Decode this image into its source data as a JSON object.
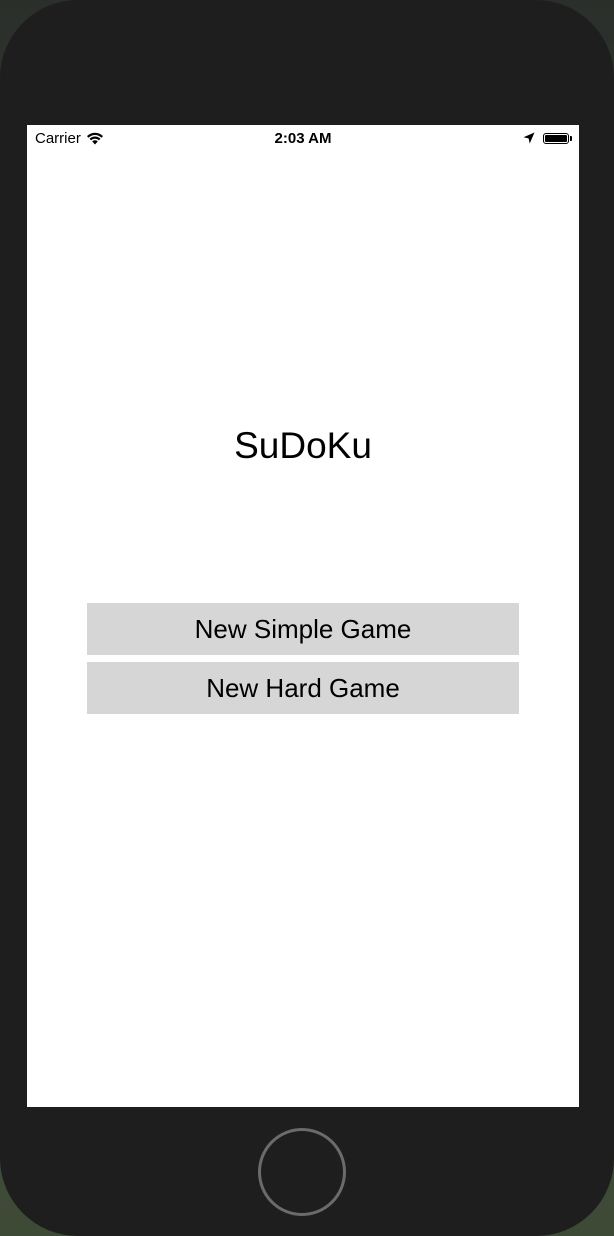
{
  "status_bar": {
    "carrier": "Carrier",
    "time": "2:03 AM",
    "icons": [
      "wifi-icon",
      "location-arrow-icon",
      "battery-icon"
    ]
  },
  "app": {
    "title": "SuDoKu",
    "buttons": {
      "simple": "New Simple Game",
      "hard": "New Hard Game"
    }
  },
  "colors": {
    "device_frame": "#1e1e1e",
    "screen_background": "#ffffff",
    "button_background": "#d6d6d6",
    "home_button_ring": "#6b6b6b"
  }
}
